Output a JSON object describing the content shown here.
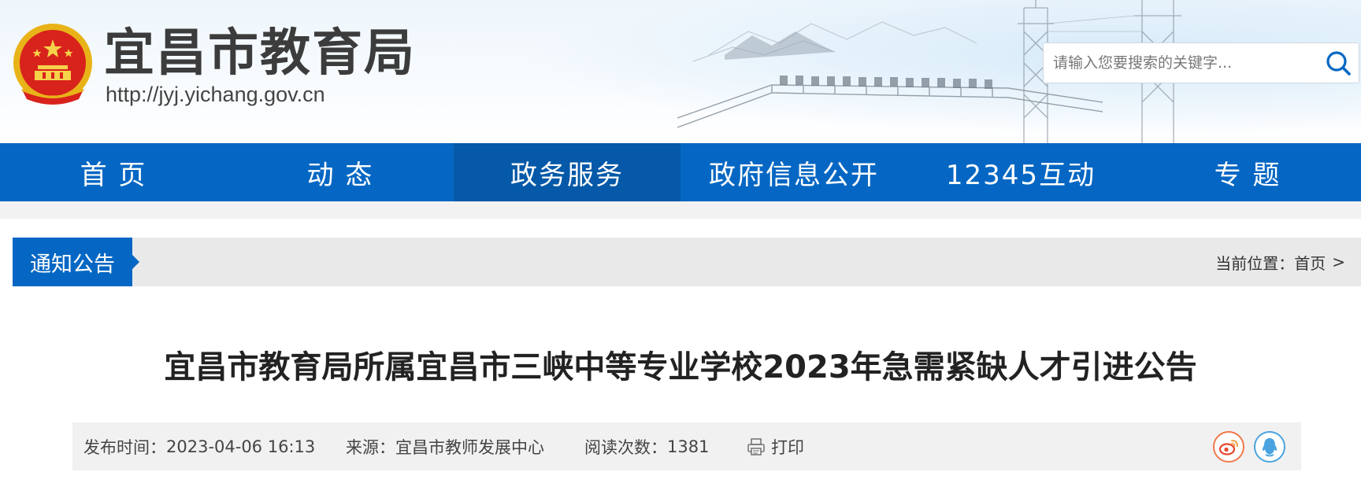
{
  "header": {
    "site_title": "宜昌市教育局",
    "site_url": "http://jyj.yichang.gov.cn",
    "emblem_icon": "national-emblem-icon"
  },
  "search": {
    "placeholder": "请输入您要搜索的关键字...",
    "button_icon": "search-icon"
  },
  "nav": {
    "items": [
      {
        "label": "首 页"
      },
      {
        "label": "动 态"
      },
      {
        "label": "政务服务"
      },
      {
        "label": "政府信息公开"
      },
      {
        "label": "12345互动"
      },
      {
        "label": "专 题"
      }
    ],
    "active_index": 2
  },
  "section": {
    "tab_label": "通知公告",
    "breadcrumb_prefix": "当前位置：",
    "breadcrumb_home": "首页",
    "breadcrumb_separator": ">"
  },
  "article": {
    "title": "宜昌市教育局所属宜昌市三峡中等专业学校2023年急需紧缺人才引进公告",
    "publish_label": "发布时间：",
    "publish_time": "2023-04-06 16:13",
    "source_label": "来源：",
    "source": "宜昌市教师发展中心",
    "views_label": "阅读次数：",
    "views": "1381",
    "print_label": "打印",
    "share_icons": [
      "weibo-icon",
      "qq-icon"
    ]
  },
  "colors": {
    "nav_blue": "#0567c3",
    "weibo_orange": "#f0784a",
    "qq_blue": "#4aa3e0"
  }
}
